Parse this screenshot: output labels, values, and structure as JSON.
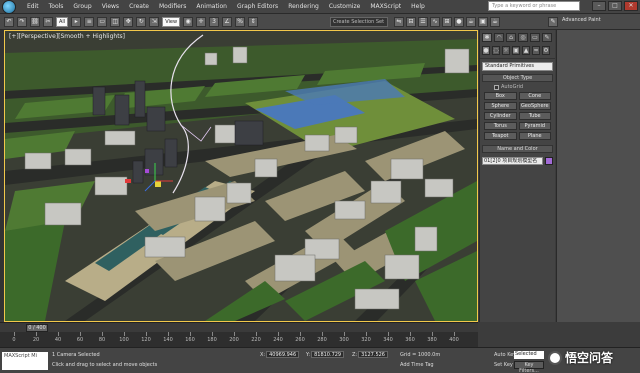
{
  "menubar": {
    "items": [
      "Edit",
      "Tools",
      "Group",
      "Views",
      "Create",
      "Modifiers",
      "Animation",
      "Graph Editors",
      "Rendering",
      "Customize",
      "MAXScript",
      "Help"
    ],
    "search_placeholder": "Type a keyword or phrase",
    "window_controls": [
      "–",
      "□",
      "✕"
    ]
  },
  "toolbar": {
    "selection_filter": "All",
    "reference_coord": "View",
    "named_selection": "Create Selection Set",
    "advanced_paint": "Advanced Paint"
  },
  "viewport": {
    "label": "[+][Perspective][Smooth + Highlights]",
    "accent_color": "#f2c84b"
  },
  "command_panel": {
    "tab_icons": [
      "create-icon",
      "modify-icon",
      "hierarchy-icon",
      "motion-icon",
      "display-icon",
      "utilities-icon"
    ],
    "category": "Standard Primitives",
    "object_type_title": "Object Type",
    "autogrid_label": "AutoGrid",
    "object_buttons": [
      "Box",
      "Cone",
      "Sphere",
      "GeoSphere",
      "Cylinder",
      "Tube",
      "Torus",
      "Pyramid",
      "Teapot",
      "Plane"
    ],
    "name_color_title": "Name and Color",
    "name_value": "01[2]0 项目规划模型名",
    "swatch_color": "#a26bd6"
  },
  "timeline": {
    "slider_label": "0 / 400",
    "ticks": [
      "0",
      "20",
      "40",
      "60",
      "80",
      "100",
      "120",
      "140",
      "160",
      "180",
      "200",
      "220",
      "240",
      "260",
      "280",
      "300",
      "320",
      "340",
      "360",
      "380",
      "400"
    ]
  },
  "status": {
    "maxscript": "MAXScript Mi",
    "selected": "1 Camera Selected",
    "prompt": "Click and drag to select and move objects",
    "x_label": "X:",
    "x_value": "40969.946",
    "y_label": "Y:",
    "y_value": "81810.729",
    "z_label": "Z:",
    "z_value": "3127.526",
    "grid": "Grid = 1000.0m",
    "add_time_tag": "Add Time Tag",
    "auto_key": "Auto Key",
    "set_key": "Set Key",
    "selected_dropdown": "Selected",
    "key_filters": "Key Filters..."
  },
  "watermark": {
    "text": "悟空问答"
  }
}
